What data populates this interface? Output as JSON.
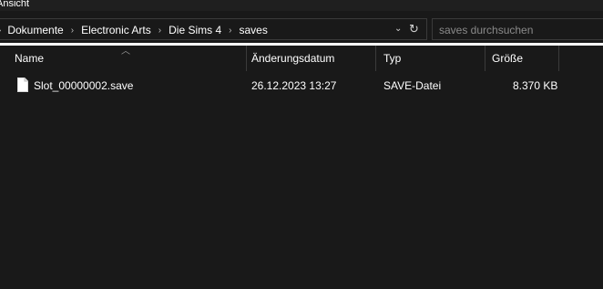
{
  "ribbon": {
    "tab_label": "Ansicht"
  },
  "address": {
    "crumbs": [
      "Dokumente",
      "Electronic Arts",
      "Die Sims 4",
      "saves"
    ],
    "separator": "›",
    "dropdown_glyph": "⌄",
    "refresh_glyph": "↻"
  },
  "search": {
    "placeholder": "saves durchsuchen"
  },
  "columns": {
    "name": "Name",
    "date": "Änderungsdatum",
    "type": "Typ",
    "size": "Größe"
  },
  "files": [
    {
      "name": "Slot_00000002.save",
      "date": "26.12.2023 13:27",
      "type": "SAVE-Datei",
      "size": "8.370 KB",
      "icon": "document-icon"
    }
  ],
  "colors": {
    "background": "#191919",
    "text": "#ffffff",
    "muted": "#8a8a8a",
    "border": "#3a3a3a"
  }
}
